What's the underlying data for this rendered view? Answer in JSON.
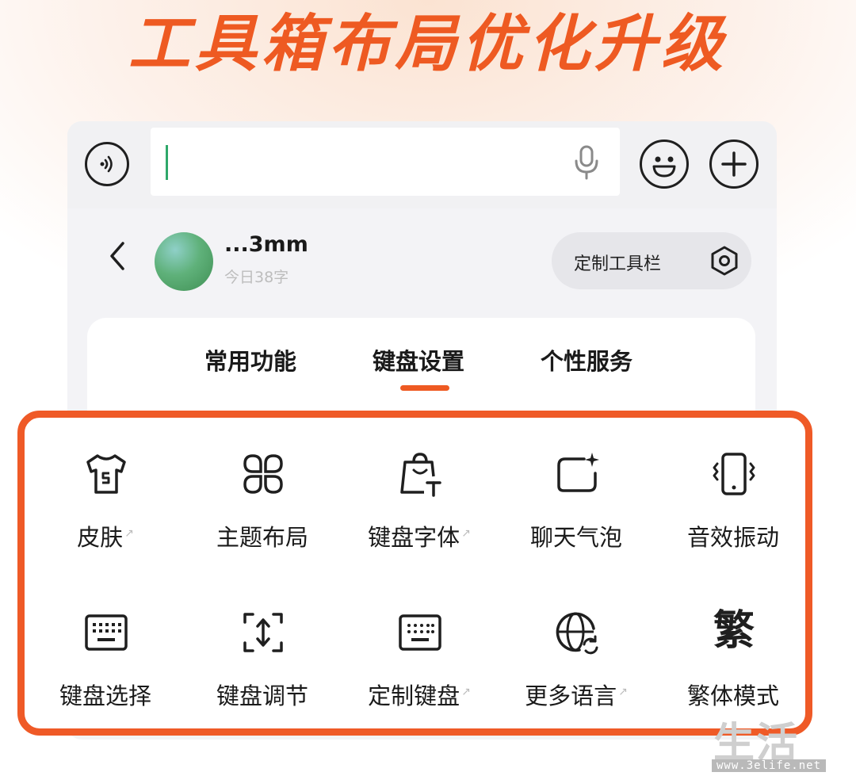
{
  "banner": {
    "title": "工具箱布局优化升级"
  },
  "header": {
    "user_name": "...3mm",
    "word_count": "今日38字",
    "customize_label": "定制工具栏"
  },
  "tabs": [
    {
      "label": "常用功能"
    },
    {
      "label": "键盘设置"
    },
    {
      "label": "个性服务"
    }
  ],
  "active_tab": "键盘设置",
  "grid": [
    {
      "label": "皮肤",
      "icon": "tshirt-icon",
      "external": true
    },
    {
      "label": "主题布局",
      "icon": "four-petal-grid-icon",
      "external": false
    },
    {
      "label": "键盘字体",
      "icon": "shopping-bag-text-icon",
      "external": true
    },
    {
      "label": "聊天气泡",
      "icon": "sparkle-bubble-icon",
      "external": false
    },
    {
      "label": "音效振动",
      "icon": "vibrating-phone-icon",
      "external": false
    },
    {
      "label": "键盘选择",
      "icon": "keyboard-icon",
      "external": false
    },
    {
      "label": "键盘调节",
      "icon": "resize-vertical-icon",
      "external": false
    },
    {
      "label": "定制键盘",
      "icon": "keyboard-dots-icon",
      "external": true
    },
    {
      "label": "更多语言",
      "icon": "globe-icon",
      "external": true
    },
    {
      "label": "繁体模式",
      "icon": "traditional-char-icon",
      "external": false
    }
  ],
  "traditional_glyph": "繁",
  "watermark": {
    "text": "生活",
    "url": "www.3elife.net"
  },
  "colors": {
    "accent": "#ee5a22",
    "highlight_border": "#ef5a27",
    "cursor": "#2fa86a"
  }
}
